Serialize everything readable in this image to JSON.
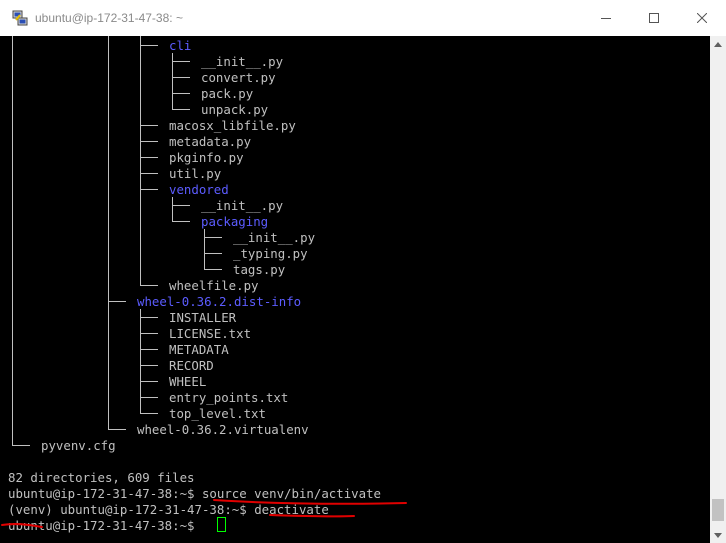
{
  "window": {
    "title": "ubuntu@ip-172-31-47-38: ~",
    "icons": {
      "app": "putty-icon",
      "minimize": "minimize-icon",
      "maximize": "maximize-icon",
      "close": "close-icon"
    }
  },
  "terminal": {
    "tree": [
      {
        "name": "cli",
        "type": "dir"
      },
      {
        "name": "__init__.py",
        "type": "file"
      },
      {
        "name": "convert.py",
        "type": "file"
      },
      {
        "name": "pack.py",
        "type": "file"
      },
      {
        "name": "unpack.py",
        "type": "file"
      },
      {
        "name": "macosx_libfile.py",
        "type": "file"
      },
      {
        "name": "metadata.py",
        "type": "file"
      },
      {
        "name": "pkginfo.py",
        "type": "file"
      },
      {
        "name": "util.py",
        "type": "file"
      },
      {
        "name": "vendored",
        "type": "dir"
      },
      {
        "name": "__init__.py",
        "type": "file"
      },
      {
        "name": "packaging",
        "type": "dir"
      },
      {
        "name": "__init__.py",
        "type": "file"
      },
      {
        "name": "_typing.py",
        "type": "file"
      },
      {
        "name": "tags.py",
        "type": "file"
      },
      {
        "name": "wheelfile.py",
        "type": "file"
      },
      {
        "name": "wheel-0.36.2.dist-info",
        "type": "dir"
      },
      {
        "name": "INSTALLER",
        "type": "file"
      },
      {
        "name": "LICENSE.txt",
        "type": "file"
      },
      {
        "name": "METADATA",
        "type": "file"
      },
      {
        "name": "RECORD",
        "type": "file"
      },
      {
        "name": "WHEEL",
        "type": "file"
      },
      {
        "name": "entry_points.txt",
        "type": "file"
      },
      {
        "name": "top_level.txt",
        "type": "file"
      },
      {
        "name": "wheel-0.36.2.virtualenv",
        "type": "file"
      },
      {
        "name": "pyvenv.cfg",
        "type": "file"
      }
    ],
    "summary": "82 directories, 609 files",
    "commands": [
      {
        "prompt": "ubuntu@ip-172-31-47-38:~$",
        "command": "source venv/bin/activate"
      },
      {
        "prompt": "(venv) ubuntu@ip-172-31-47-38:~$",
        "command": "deactivate"
      },
      {
        "prompt": "ubuntu@ip-172-31-47-38:~$",
        "command": ""
      }
    ]
  },
  "annotation_color": "#e00000",
  "colors": {
    "directory": "#5c5cff",
    "text": "#c0c0c0",
    "cursor": "#00ff00"
  }
}
